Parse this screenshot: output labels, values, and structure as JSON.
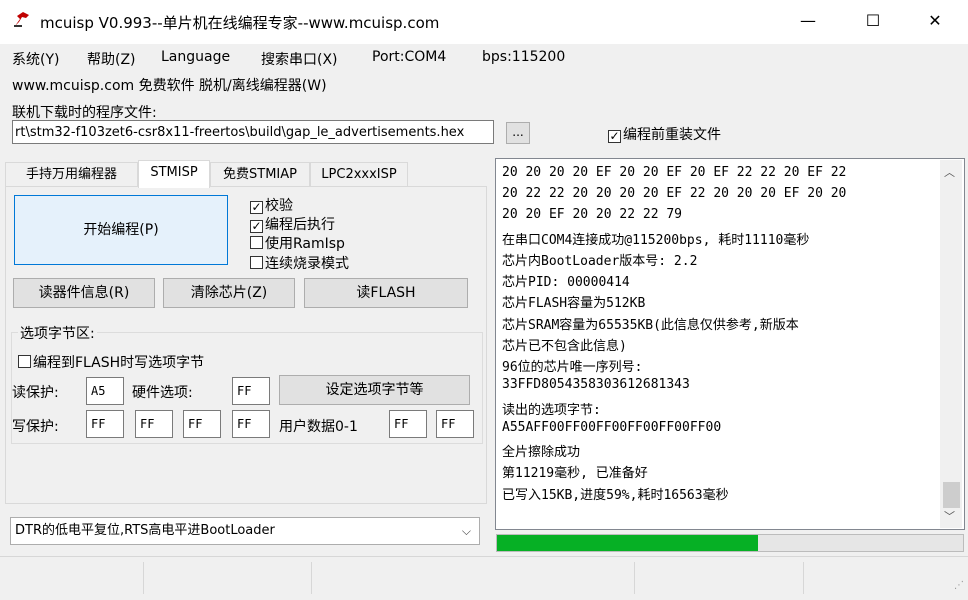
{
  "window": {
    "title": "mcuisp V0.993--单片机在线编程专家--www.mcuisp.com",
    "minimize": "—",
    "maximize": "☐",
    "close": "✕"
  },
  "menu": {
    "items": [
      "系统(Y)",
      "帮助(Z)",
      "Language",
      "搜索串口(X)",
      "Port:COM4",
      "bps:115200"
    ]
  },
  "subline": "www.mcuisp.com 免费软件 脱机/离线编程器(W)",
  "file": {
    "label": "联机下载时的程序文件:",
    "path": "rt\\stm32-f103zet6-csr8x11-freertos\\build\\gap_le_advertisements.hex",
    "browse": "...",
    "reinstall_label": "编程前重装文件",
    "reinstall_checked": true
  },
  "tabs": [
    "手持万用编程器",
    "STMISP",
    "免费STMIAP",
    "LPC2xxxISP"
  ],
  "active_tab": "STMISP",
  "program_button": "开始编程(P)",
  "options": [
    {
      "label": "校验",
      "checked": true
    },
    {
      "label": "编程后执行",
      "checked": true
    },
    {
      "label": "使用RamIsp",
      "checked": false
    },
    {
      "label": "连续烧录模式",
      "checked": false
    }
  ],
  "actions": {
    "read_info": "读器件信息(R)",
    "erase_chip": "清除芯片(Z)",
    "read_flash": "读FLASH"
  },
  "option_bytes": {
    "group_title": "选项字节区:",
    "write_on_program": "编程到FLASH时写选项字节",
    "write_on_program_checked": false,
    "read_protect_label": "读保护:",
    "read_protect": "A5",
    "hw_option_label": "硬件选项:",
    "hw_option": "FF",
    "set_button": "设定选项字节等",
    "write_protect_label": "写保护:",
    "write_protect": [
      "FF",
      "FF",
      "FF",
      "FF"
    ],
    "user_data_label": "用户数据0-1",
    "user_data": [
      "FF",
      "FF"
    ]
  },
  "reset_mode": "DTR的低电平复位,RTS高电平进BootLoader",
  "log_lines": [
    "20 20 20 20 EF 20 20 EF 20 EF 22 22 20 EF 22",
    "20 22 22 20 20 20 20 EF 22 20 20 20 EF 20 20",
    "20 20 EF 20 20 22 22 79",
    "在串口COM4连接成功@115200bps, 耗时11110毫秒",
    "芯片内BootLoader版本号: 2.2",
    "芯片PID: 00000414",
    "芯片FLASH容量为512KB",
    "芯片SRAM容量为65535KB(此信息仅供参考,新版本",
    "芯片已不包含此信息)",
    "96位的芯片唯一序列号:",
    "33FFD8054358303612681343",
    "读出的选项字节:",
    "A55AFF00FF00FF00FF00FF00FF00",
    "全片擦除成功",
    "第11219毫秒, 已准备好",
    "已写入15KB,进度59%,耗时16563毫秒"
  ],
  "progress_fraction": 0.56,
  "colors": {
    "accent": "#0078d7",
    "progress": "#06b025",
    "icon": "#c00000"
  }
}
